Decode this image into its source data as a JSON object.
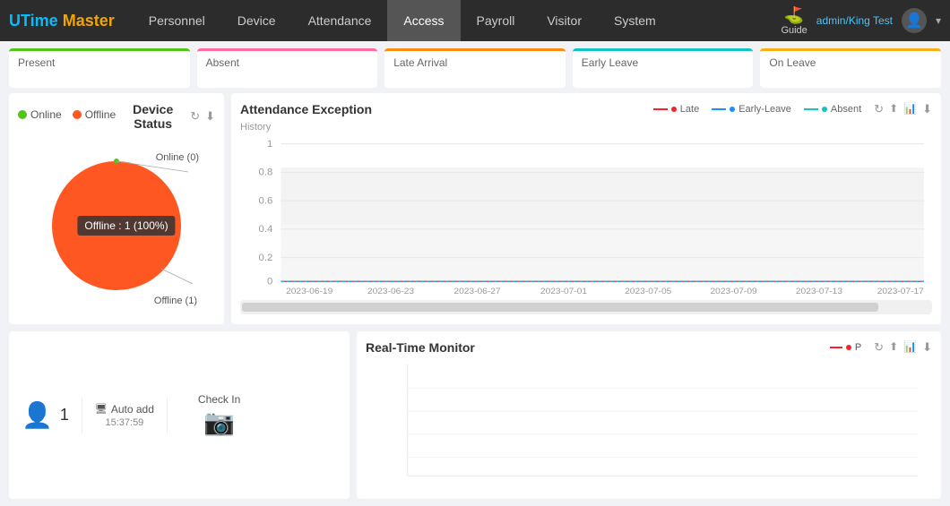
{
  "navbar": {
    "logo_u": "U",
    "logo_time": "Time",
    "logo_master": "Master",
    "items": [
      {
        "label": "Personnel",
        "active": false
      },
      {
        "label": "Device",
        "active": false
      },
      {
        "label": "Attendance",
        "active": false
      },
      {
        "label": "Access",
        "active": false
      },
      {
        "label": "Payroll",
        "active": false
      },
      {
        "label": "Visitor",
        "active": false
      },
      {
        "label": "System",
        "active": false
      }
    ],
    "guide_label": "Guide",
    "user_name": "admin/King Test"
  },
  "status_cards": [
    {
      "label": "Present",
      "color": "green"
    },
    {
      "label": "Absent",
      "color": "pink"
    },
    {
      "label": "Late Arrival",
      "color": "orange"
    },
    {
      "label": "Early Leave",
      "color": "cyan"
    },
    {
      "label": "On Leave",
      "color": "yellow"
    }
  ],
  "device_status": {
    "title": "Device Status",
    "legend_online": "Online",
    "legend_offline": "Offline",
    "pie_label_online": "Online (0)",
    "pie_label_offline": "Offline (1)",
    "tooltip": "Offline : 1 (100%)",
    "refresh_icon": "↻",
    "download_icon": "⬇"
  },
  "attendance_exception": {
    "title": "Attendance Exception",
    "history_label": "History",
    "legend_late": "Late",
    "legend_early_leave": "Early-Leave",
    "legend_absent": "Absent",
    "y_axis": [
      "1",
      "0.8",
      "0.6",
      "0.4",
      "0.2",
      "0"
    ],
    "x_axis": [
      "2023-06-19",
      "2023-06-23",
      "2023-06-27",
      "2023-07-01",
      "2023-07-05",
      "2023-07-09",
      "2023-07-13",
      "2023-07-17"
    ],
    "refresh_icon": "↻",
    "upload_icon": "⬆",
    "chart_icon": "📊",
    "download_icon": "⬇"
  },
  "checkin_monitor": {
    "person_count": "1",
    "auto_add_label": "Auto add",
    "auto_add_time": "15:37:59",
    "checkin_label": "Check In"
  },
  "realtime_monitor": {
    "title": "Real-Time Monitor",
    "legend_p": "P",
    "refresh_icon": "↻",
    "upload_icon": "⬆",
    "chart_icon": "📊",
    "download_icon": "⬇"
  }
}
